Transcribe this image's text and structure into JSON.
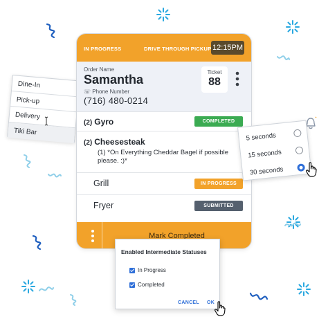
{
  "colors": {
    "accent": "#f2a22a",
    "in_progress": "#f2a22a",
    "completed": "#3bab52",
    "submitted": "#55606e",
    "link": "#2f6fd8"
  },
  "order_card": {
    "header": {
      "status": "IN PROGRESS",
      "order_type": "DRIVE THROUGH PICKUP",
      "time": "12:15PM"
    },
    "customer": {
      "name_label": "Order Name",
      "name": "Samantha",
      "phone_label": "Phone Number",
      "phone": "(716) 480-0214",
      "ticket_label": "Ticket",
      "ticket_number": "88"
    },
    "items": [
      {
        "qty": "(2)",
        "name": "Gyro",
        "status": "COMPLETED"
      },
      {
        "qty": "(2)",
        "name": "Cheesesteak",
        "note": "(1) *On Everything Cheddar Bagel if possible please. :)*"
      }
    ],
    "stations": [
      {
        "name": "Grill",
        "status": "IN PROGRESS"
      },
      {
        "name": "Fryer",
        "status": "SUBMITTED"
      }
    ],
    "footer": {
      "action_label": "Mark Completed"
    }
  },
  "order_type_menu": {
    "items": [
      "Dine-In",
      "Pick-up",
      "Delivery",
      "Tiki Bar"
    ]
  },
  "timer_menu": {
    "options": [
      "5 seconds",
      "15 seconds",
      "30 seconds"
    ],
    "selected": "30 seconds"
  },
  "status_dialog": {
    "title": "Enabled Intermediate Statuses",
    "options": [
      {
        "label": "In Progress",
        "checked": true
      },
      {
        "label": "Completed",
        "checked": true
      }
    ],
    "cancel_label": "CANCEL",
    "ok_label": "OK"
  }
}
